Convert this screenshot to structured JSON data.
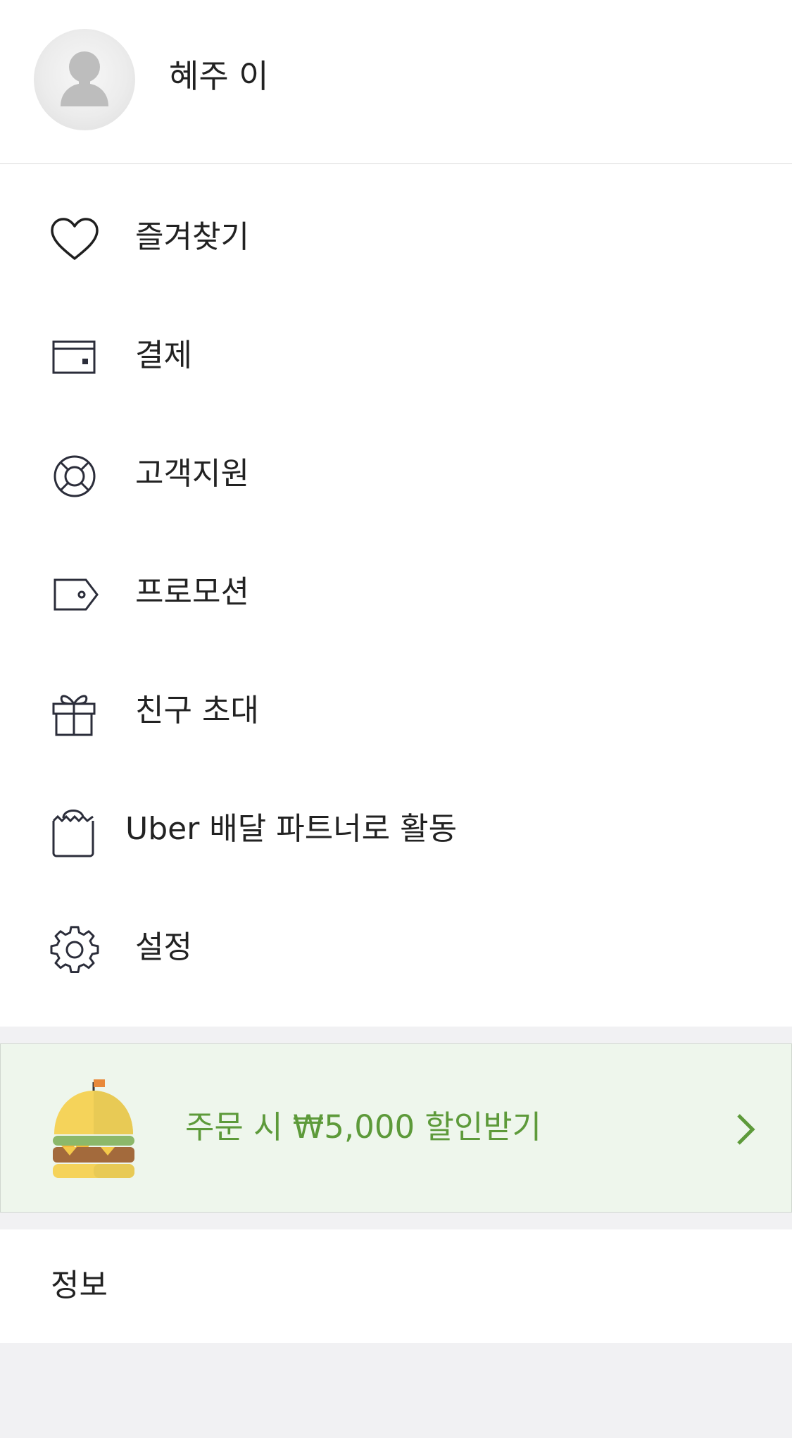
{
  "profile": {
    "name": "혜주 이",
    "avatar_icon": "person-placeholder-icon"
  },
  "menu": {
    "items": [
      {
        "label": "즐겨찾기",
        "icon": "heart-icon"
      },
      {
        "label": "결제",
        "icon": "wallet-icon"
      },
      {
        "label": "고객지원",
        "icon": "lifebuoy-icon"
      },
      {
        "label": "프로모션",
        "icon": "tag-icon"
      },
      {
        "label": "친구 초대",
        "icon": "gift-icon"
      },
      {
        "label": "Uber 배달 파트너로 활동",
        "icon": "bag-icon"
      },
      {
        "label": "설정",
        "icon": "gear-icon"
      }
    ]
  },
  "promo": {
    "text": "주문 시 ₩5,000 할인받기",
    "icon": "burger-icon",
    "chevron": "chevron-right-icon",
    "accent_color": "#5d9a3a",
    "background_color": "#eef6ec"
  },
  "info": {
    "label": "정보"
  }
}
